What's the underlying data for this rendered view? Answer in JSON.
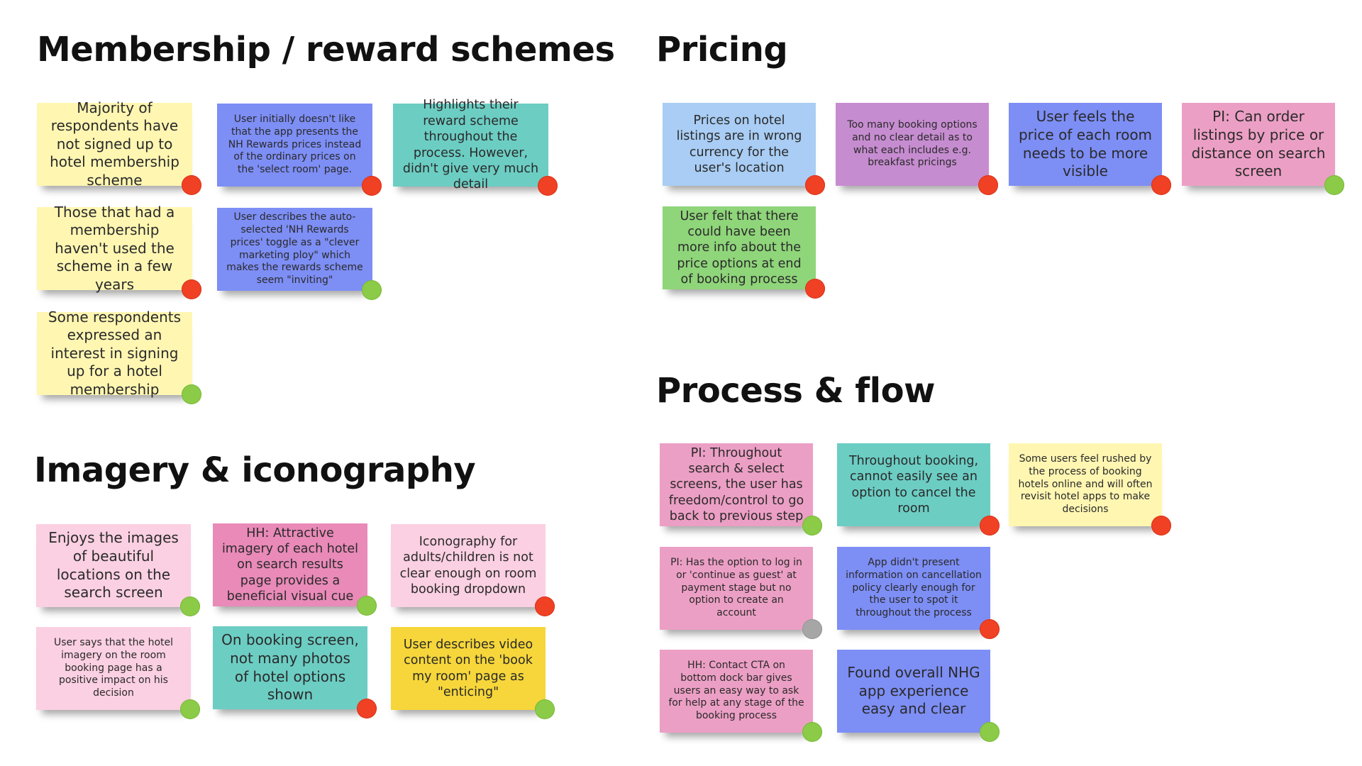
{
  "colors": {
    "yellow": "#fff6b2",
    "blue_violet": "#7d8ef5",
    "teal": "#6ccdc3",
    "light_blue": "#a9cdf4",
    "purple": "#c68cd0",
    "pink": "#ec9fc4",
    "green": "#8fd57a",
    "light_pink": "#fbd0e2",
    "hot_pink": "#e98ab8",
    "gold": "#f6d63a",
    "status_negative": "#f04124",
    "status_positive": "#8bcb47",
    "status_neutral": "#a6a6a6"
  },
  "sections": {
    "membership": {
      "title": "Membership / reward schemes",
      "notes": [
        {
          "text": "Majority of respondents have not signed up to hotel membership scheme",
          "color": "yellow",
          "status": "negative"
        },
        {
          "text": "User initially doesn't like that the app presents the NH Rewards prices instead of the ordinary prices on the 'select room' page.",
          "color": "blue_violet",
          "status": "negative"
        },
        {
          "text": "Highlights their reward scheme throughout the process. However, didn't give very much detail",
          "color": "teal",
          "status": "negative"
        },
        {
          "text": "Those that had a membership haven't used the scheme in a few years",
          "color": "yellow",
          "status": "negative"
        },
        {
          "text": "User describes the auto-selected 'NH Rewards prices' toggle as a \"clever marketing ploy\" which makes the rewards scheme seem \"inviting\"",
          "color": "blue_violet",
          "status": "positive"
        },
        {
          "text": "Some respondents expressed an interest in signing up for a hotel membership",
          "color": "yellow",
          "status": "positive"
        }
      ]
    },
    "pricing": {
      "title": "Pricing",
      "notes": [
        {
          "text": "Prices on hotel listings are in wrong currency for the user's location",
          "color": "light_blue",
          "status": "negative"
        },
        {
          "text": "Too many booking options and no clear detail as to what each includes e.g. breakfast pricings",
          "color": "purple",
          "status": "negative"
        },
        {
          "text": "User feels the price of each room needs to be more visible",
          "color": "blue_violet",
          "status": "negative"
        },
        {
          "text": "PI: Can order listings by price or distance on search screen",
          "color": "pink",
          "status": "positive"
        },
        {
          "text": "User felt that there could have been more info about the price options at end of booking process",
          "color": "green",
          "status": "negative"
        }
      ]
    },
    "imagery": {
      "title": "Imagery & iconography",
      "notes": [
        {
          "text": "Enjoys the images of beautiful locations on the search screen",
          "color": "light_pink",
          "status": "positive"
        },
        {
          "text": "HH: Attractive imagery of each hotel on search results page provides a beneficial visual cue",
          "color": "hot_pink",
          "status": "positive"
        },
        {
          "text": "Iconography for adults/children is not clear enough on room booking dropdown",
          "color": "light_pink",
          "status": "negative"
        },
        {
          "text": "User says that the hotel imagery on the room booking page has a positive impact on his decision",
          "color": "light_pink",
          "status": "positive"
        },
        {
          "text": "On booking screen, not many photos of hotel options shown",
          "color": "teal",
          "status": "negative"
        },
        {
          "text": "User describes video content on the 'book my room' page as \"enticing\"",
          "color": "gold",
          "status": "positive"
        }
      ]
    },
    "process": {
      "title": "Process & flow",
      "notes": [
        {
          "text": "PI: Throughout search & select screens, the user has freedom/control to go back to previous step",
          "color": "pink",
          "status": "positive"
        },
        {
          "text": "Throughout booking, cannot easily see an option to cancel the room",
          "color": "teal",
          "status": "negative"
        },
        {
          "text": "Some users feel rushed by the process of booking hotels online and will often revisit hotel apps to make decisions",
          "color": "yellow",
          "status": "negative"
        },
        {
          "text": "PI: Has the option to log in or 'continue as guest' at payment stage but no option to create an account",
          "color": "pink",
          "status": "neutral"
        },
        {
          "text": "App didn't present information on cancellation policy clearly enough for the user to spot it throughout the process",
          "color": "blue_violet",
          "status": "negative"
        },
        {
          "text": "HH: Contact CTA on bottom dock bar gives users an easy way to ask for help at any stage of the booking process",
          "color": "pink",
          "status": "positive"
        },
        {
          "text": "Found overall NHG app experience easy and clear",
          "color": "blue_violet",
          "status": "positive"
        }
      ]
    }
  }
}
